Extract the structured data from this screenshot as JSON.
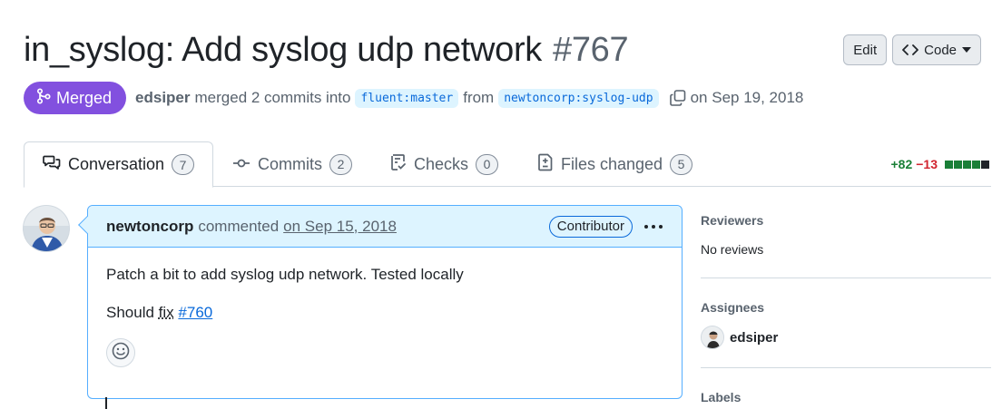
{
  "pr": {
    "title": "in_syslog: Add syslog udp network",
    "number": "#767",
    "state": "Merged",
    "author": "edsiper",
    "merge_text": "merged 2 commits into",
    "base_branch": "fluent:master",
    "from_text": "from",
    "head_branch": "newtoncorp:syslog-udp",
    "merged_on": "on Sep 19, 2018"
  },
  "header_actions": {
    "edit_label": "Edit",
    "code_label": "Code"
  },
  "tabs": [
    {
      "label": "Conversation",
      "count": "7",
      "icon": "comment-discussion-icon"
    },
    {
      "label": "Commits",
      "count": "2",
      "icon": "git-commit-icon"
    },
    {
      "label": "Checks",
      "count": "0",
      "icon": "checklist-icon"
    },
    {
      "label": "Files changed",
      "count": "5",
      "icon": "file-diff-icon"
    }
  ],
  "diffstat": {
    "additions": "+82",
    "deletions": "−13",
    "blocks": [
      "add",
      "add",
      "add",
      "add",
      "neutral"
    ]
  },
  "comment": {
    "author": "newtoncorp",
    "action": "commented",
    "date": "on Sep 15, 2018",
    "role": "Contributor",
    "body_line1": "Patch a bit to add syslog udp network. Tested locally",
    "body_line2_prefix": "Should",
    "body_line2_fix": "fix",
    "body_line2_link": "#760"
  },
  "sidebar": {
    "reviewers_title": "Reviewers",
    "reviewers_value": "No reviews",
    "assignees_title": "Assignees",
    "assignee_name": "edsiper",
    "labels_title": "Labels"
  },
  "colors": {
    "merged_purple": "#8250df",
    "link_blue": "#0969da",
    "add_green": "#1a7f37",
    "del_red": "#d1242f",
    "comment_header_bg": "#ddf4ff"
  }
}
